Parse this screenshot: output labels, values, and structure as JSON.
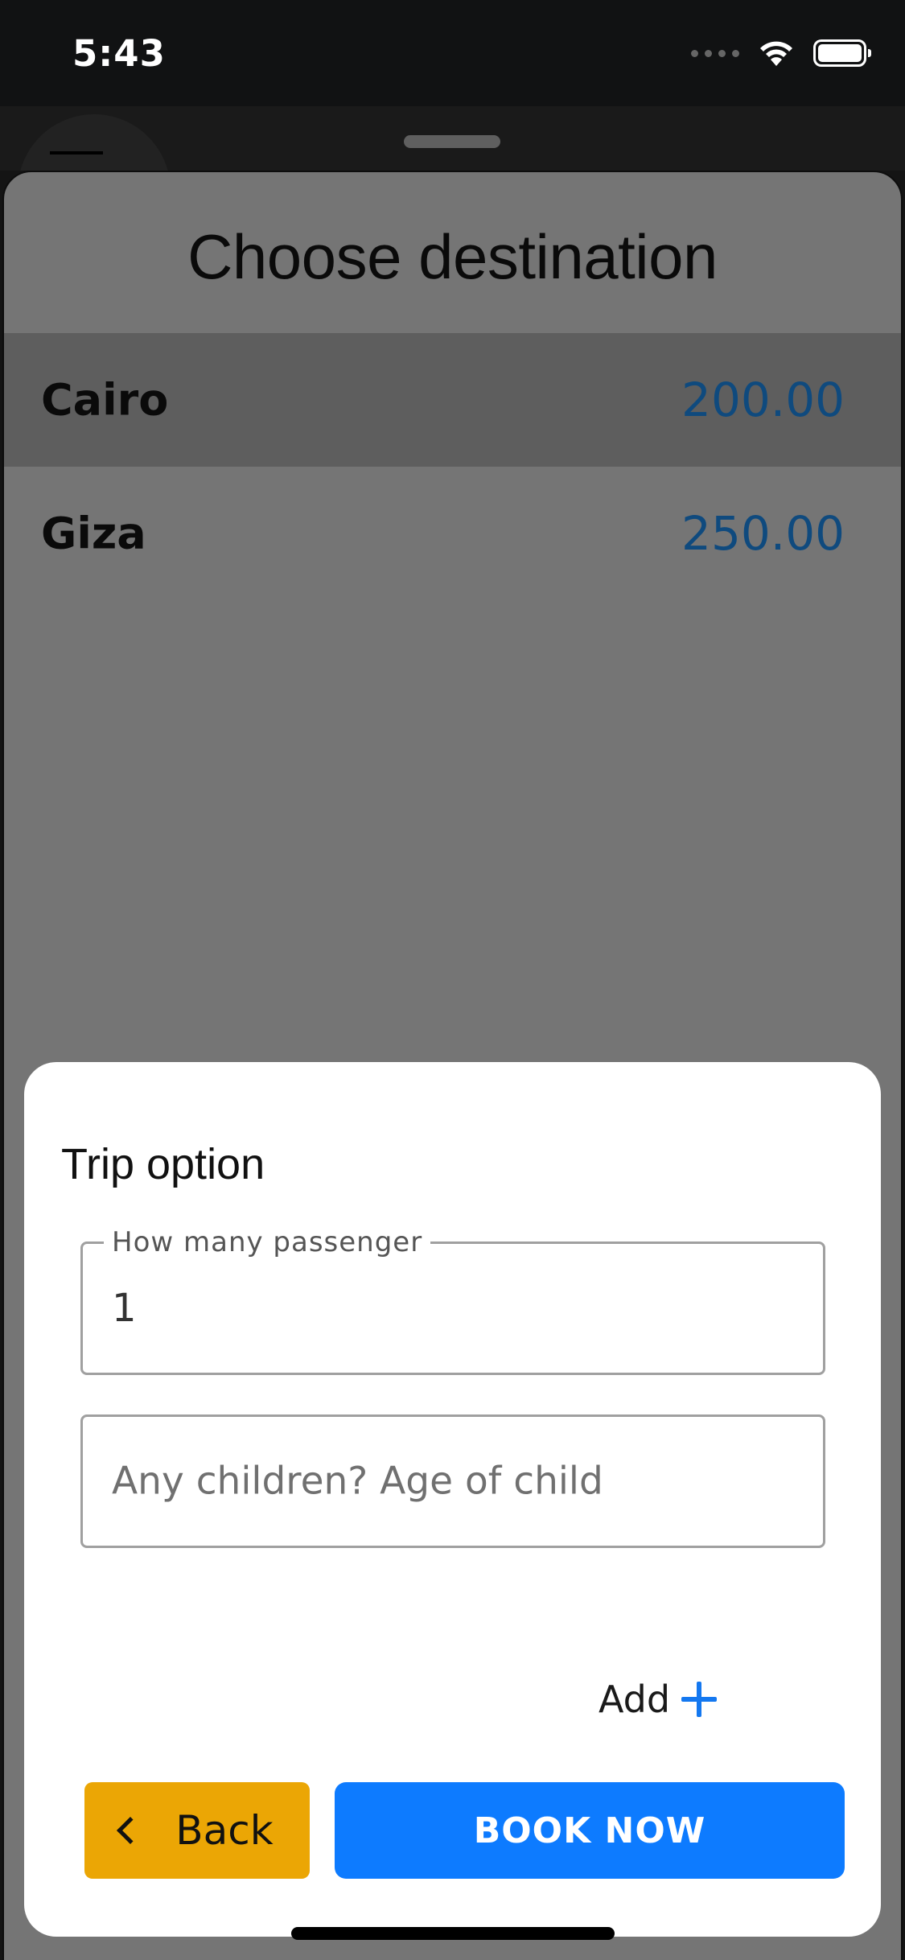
{
  "status_bar": {
    "time": "5:43",
    "icons": [
      "signal-icon",
      "wifi-icon",
      "battery-icon"
    ]
  },
  "sheet": {
    "title": "Choose destination",
    "destinations": [
      {
        "name": "Cairo",
        "price": "200.00",
        "selected": true
      },
      {
        "name": "Giza",
        "price": "250.00",
        "selected": false
      }
    ],
    "price_color": "#0f4a7e"
  },
  "modal": {
    "title": "Trip option",
    "passenger_field": {
      "label": "How many passenger",
      "value": "1"
    },
    "children_field": {
      "placeholder": "Any children? Age of child"
    },
    "add_label": "Add",
    "back_label": "Back",
    "book_label": "BOOK NOW",
    "colors": {
      "back_button": "#eba605",
      "book_button": "#0d7bff",
      "plus_icon": "#1478f0"
    }
  }
}
